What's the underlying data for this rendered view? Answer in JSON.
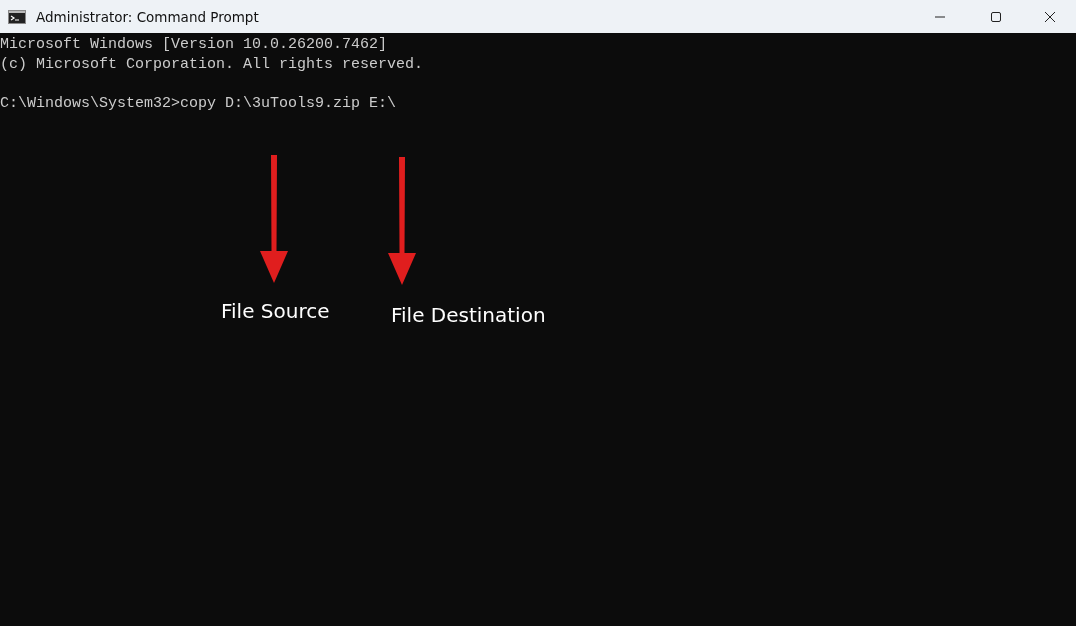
{
  "window": {
    "title": "Administrator: Command Prompt"
  },
  "console": {
    "output_lines": [
      "Microsoft Windows [Version 10.0.26200.7462]",
      "(c) Microsoft Corporation. All rights reserved."
    ],
    "input_line": "C:\\Windows\\System32>copy D:\\3uTools9.zip E:\\"
  },
  "annotations": [
    {
      "label": "File Source"
    },
    {
      "label": "File Destination"
    }
  ]
}
